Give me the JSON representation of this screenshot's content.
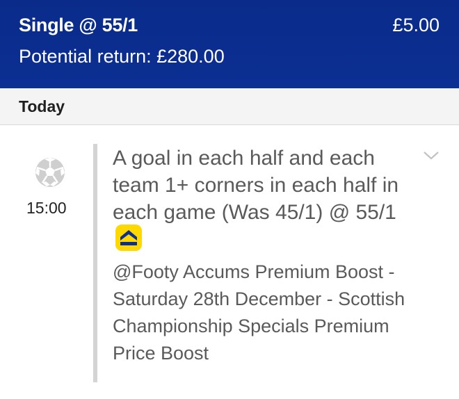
{
  "header": {
    "bet_title": "Single @ 55/1",
    "stake": "£5.00",
    "potential_return": "Potential return: £280.00"
  },
  "section": {
    "label": "Today"
  },
  "bet": {
    "sport_icon": "football-icon",
    "time": "15:00",
    "selection": "A goal in each half and each team 1+ corners in each half in each game (Was 45/1) @ 55/1",
    "boost_icon": "price-boost-icon",
    "market": "@Footy Accums Premium Boost - Saturday 28th December - Scottish Championship Specials Premium Price Boost",
    "expand_icon": "chevron-down-icon"
  },
  "colors": {
    "header_bg": "#0b2f93",
    "boost_badge": "#ffd800",
    "text_grey": "#5a5a5a"
  }
}
